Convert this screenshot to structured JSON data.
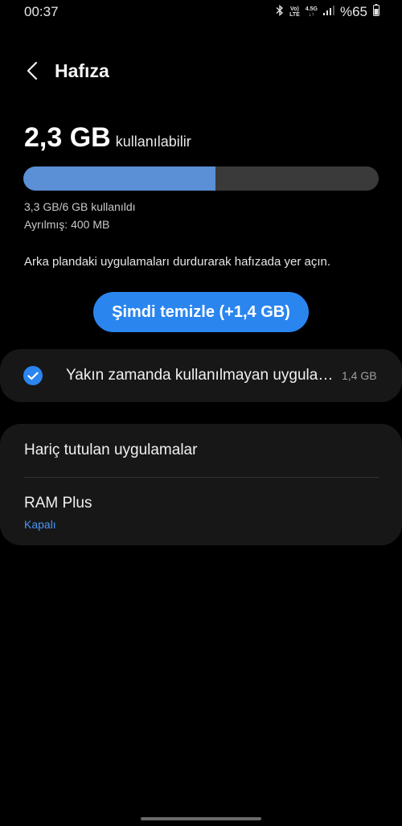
{
  "status_bar": {
    "time": "00:37",
    "volte_top": "Vo)",
    "volte_bottom": "LTE",
    "net_top": "4.5G",
    "net_bottom": "↓↑",
    "battery": "%65"
  },
  "header": {
    "title": "Hafıza"
  },
  "memory": {
    "available_value": "2,3 GB",
    "available_suffix": "kullanılabilir",
    "used_fraction": 0.54,
    "used_text": "3,3 GB/6 GB kullanıldı",
    "reserved_text": "Ayrılmış: 400 MB"
  },
  "description": "Arka plandaki uygulamaları durdurarak hafızada yer açın.",
  "clean_button": "Şimdi temizle (+1,4 GB)",
  "apps_item": {
    "label": "Yakın zamanda kullanılmayan uygulamalar",
    "size": "1,4 GB"
  },
  "settings": {
    "excluded_apps": "Hariç tutulan uygulamalar",
    "ram_plus_title": "RAM Plus",
    "ram_plus_status": "Kapalı"
  },
  "colors": {
    "accent": "#2a85ef",
    "bar_fill": "#5b8fd6",
    "bar_track": "#3a3a3a",
    "card": "#171717",
    "link": "#4a95f5"
  }
}
